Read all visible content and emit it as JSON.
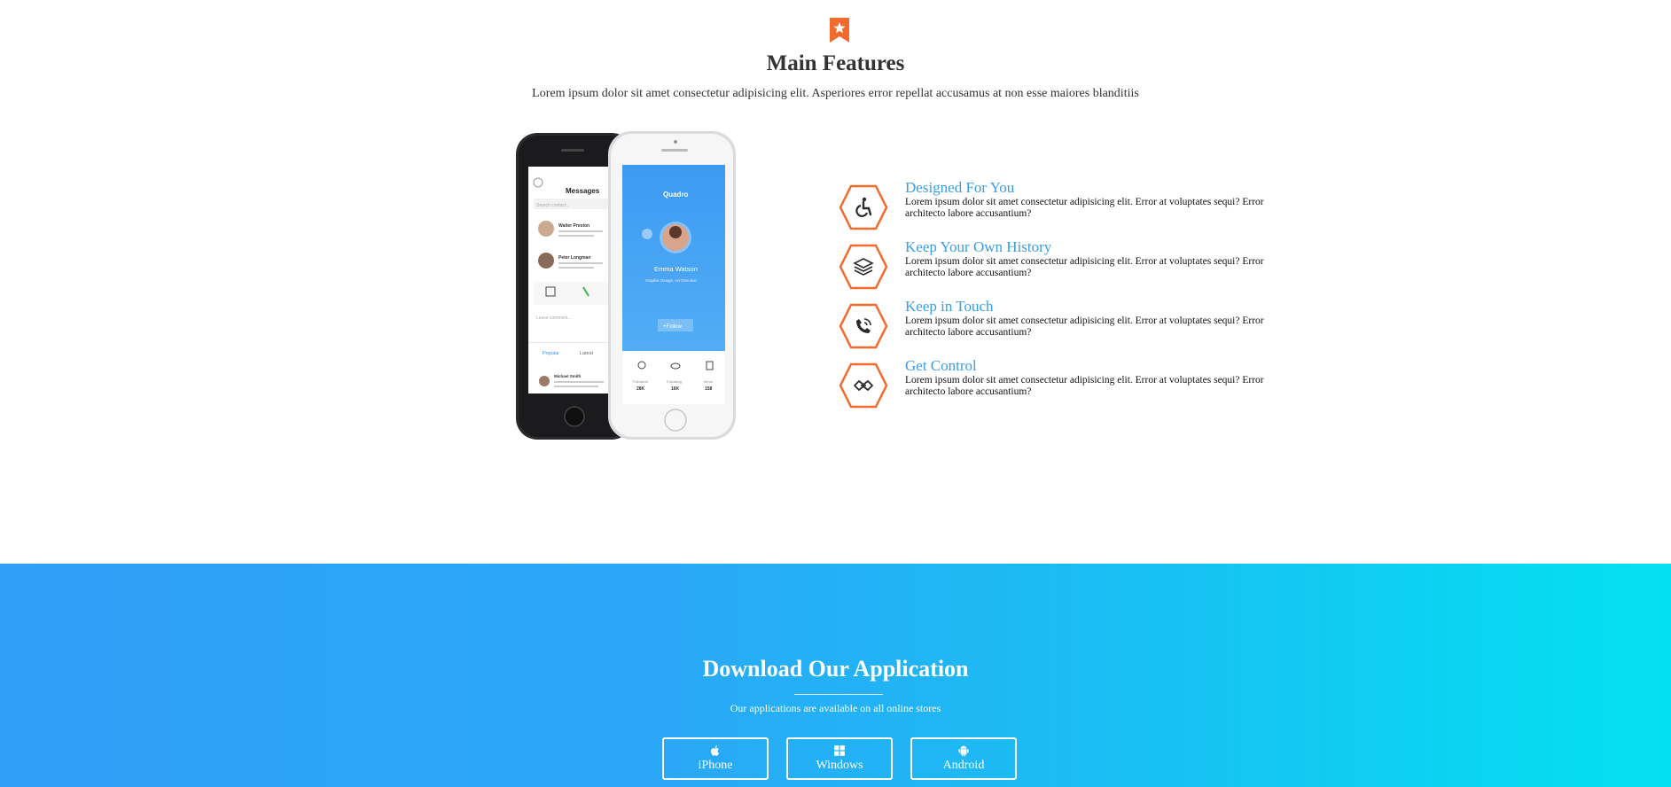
{
  "features_section": {
    "badge_icon": "bookmark-star-icon",
    "title": "Main Features",
    "subtitle": "Lorem ipsum dolor sit amet consectetur adipisicing elit. Asperiores error repellat accusamus at non esse maiores blanditiis",
    "phone_mockup": {
      "left_screen": {
        "header": "Messages",
        "search_placeholder": "Search contact...",
        "tabs": [
          "Popular",
          "Latest"
        ],
        "comment_placeholder": "Leave comment...",
        "contacts": [
          "Walter Preston",
          "Peter Longman",
          "Michael Smith"
        ]
      },
      "right_screen": {
        "app_name": "Quadro",
        "profile_name": "Emma Watson",
        "profile_role": "Graphic Design, Art Direction",
        "follow_label": "+Follow",
        "stats": [
          {
            "label": "Followers",
            "value": "28K"
          },
          {
            "label": "Following",
            "value": "16K"
          },
          {
            "label": "Items",
            "value": "158"
          }
        ]
      }
    },
    "items": [
      {
        "icon": "wheelchair-icon",
        "title": "Designed For You",
        "text": "Lorem ipsum dolor sit amet consectetur adipisicing elit. Error at voluptates sequi? Error architecto labore accusantium?"
      },
      {
        "icon": "layers-icon",
        "title": "Keep Your Own History",
        "text": "Lorem ipsum dolor sit amet consectetur adipisicing elit. Error at voluptates sequi? Error architecto labore accusantium?"
      },
      {
        "icon": "phone-volume-icon",
        "title": "Keep in Touch",
        "text": "Lorem ipsum dolor sit amet consectetur adipisicing elit. Error at voluptates sequi? Error architecto labore accusantium?"
      },
      {
        "icon": "handshake-icon",
        "title": "Get Control",
        "text": "Lorem ipsum dolor sit amet consectetur adipisicing elit. Error at voluptates sequi? Error architecto labore accusantium?"
      }
    ]
  },
  "download_section": {
    "title": "Download Our Application",
    "subtitle": "Our applications are available on all online stores",
    "buttons": [
      {
        "icon": "apple-icon",
        "label": "iPhone"
      },
      {
        "icon": "windows-icon",
        "label": "Windows"
      },
      {
        "icon": "android-icon",
        "label": "Android"
      }
    ]
  },
  "colors": {
    "accent_orange": "#f26a2e",
    "feature_title_blue": "#3a9ee6",
    "gradient_start": "#2f9ff7",
    "gradient_end": "#03e1f1"
  }
}
